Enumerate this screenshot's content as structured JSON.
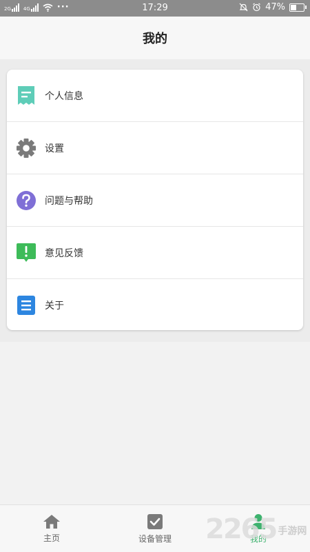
{
  "status_bar": {
    "time": "17:29",
    "battery_percent": "47%",
    "battery_level": 0.47,
    "sim1_label": "2G",
    "sim2_label": "4G",
    "more": "···"
  },
  "header": {
    "title": "我的"
  },
  "menu": {
    "items": [
      {
        "label": "个人信息",
        "icon": "profile-doc-icon",
        "color": "#5ecdb8"
      },
      {
        "label": "设置",
        "icon": "gear-icon",
        "color": "#7a7a7a"
      },
      {
        "label": "问题与帮助",
        "icon": "help-icon",
        "color": "#7f6fd6"
      },
      {
        "label": "意见反馈",
        "icon": "feedback-icon",
        "color": "#3dbb59"
      },
      {
        "label": "关于",
        "icon": "about-list-icon",
        "color": "#2d86e0"
      }
    ]
  },
  "bottom_nav": {
    "tabs": [
      {
        "label": "主页",
        "icon": "home-icon"
      },
      {
        "label": "设备管理",
        "icon": "checkbox-icon"
      },
      {
        "label": "我的",
        "icon": "person-icon",
        "active": true
      }
    ]
  },
  "watermark": {
    "number": "2265",
    "text": "手游网"
  },
  "colors": {
    "accent": "#3db26e",
    "status_bar": "#8c8c8c"
  }
}
